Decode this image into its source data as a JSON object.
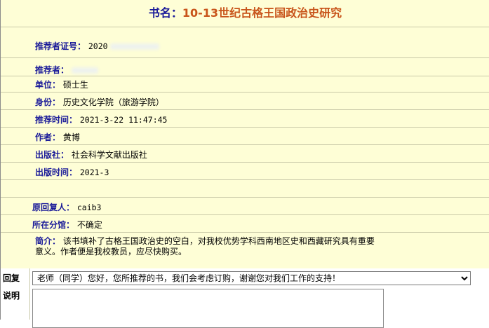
{
  "title": {
    "prefix": "书名：",
    "book_name": "10-13世纪古格王国政治史研究"
  },
  "fields": {
    "cert_label": "推荐者证号：",
    "cert_value": "2020",
    "recommender_label": "推荐者：",
    "unit_label": "单位：",
    "unit_value": "硕士生",
    "identity_label": "身份：",
    "identity_value": "历史文化学院（旅游学院）",
    "time_label": "推荐时间：",
    "time_value": "2021-3-22 11:47:45",
    "author_label": "作者：",
    "author_value": "黄博",
    "publisher_label": "出版社：",
    "publisher_value": "社会科学文献出版社",
    "pubdate_label": "出版时间：",
    "pubdate_value": "2021-3",
    "replier_label": "原回复人：",
    "replier_value": "caib3",
    "branch_label": "所在分馆：",
    "branch_value": "不确定",
    "intro_label": "简介：",
    "intro_line1": "该书填补了古格王国政治史的空白，对我校优势学科西南地区史和西藏研究具有重要",
    "intro_line2": "意义。作者便是我校教员，应尽快购买。"
  },
  "reply": {
    "label": "回复",
    "selected": "老师（同学）您好，您所推荐的书，我们会考虑订购，谢谢您对我们工作的支持！"
  },
  "note": {
    "label": "说明",
    "value": ""
  }
}
